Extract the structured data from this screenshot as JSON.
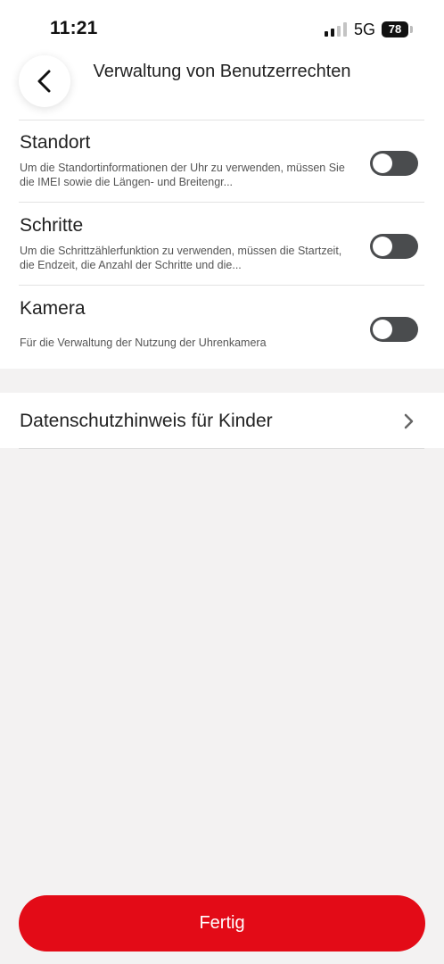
{
  "status_bar": {
    "time": "11:21",
    "network": "5G",
    "battery": "78"
  },
  "header": {
    "back_icon": "chevron-left-icon",
    "title": "Verwaltung von Benutzerrechten"
  },
  "permissions": [
    {
      "title": "Standort",
      "description": "Um die Standortinformationen der Uhr zu verwenden, müssen Sie die IMEI sowie die Längen- und Breitengr...",
      "enabled": false
    },
    {
      "title": "Schritte",
      "description": "Um die Schrittzählerfunktion zu verwenden, müssen die Startzeit, die Endzeit, die Anzahl der Schritte und die...",
      "enabled": false
    },
    {
      "title": "Kamera",
      "description": "Für die Verwaltung der Nutzung der Uhrenkamera",
      "enabled": false
    }
  ],
  "privacy_link": {
    "label": "Datenschutzhinweis für Kinder",
    "icon": "chevron-right-icon"
  },
  "footer": {
    "done_label": "Fertig"
  },
  "colors": {
    "accent": "#e30b17",
    "toggle_off": "#4a4c4e",
    "background": "#f3f2f2"
  }
}
